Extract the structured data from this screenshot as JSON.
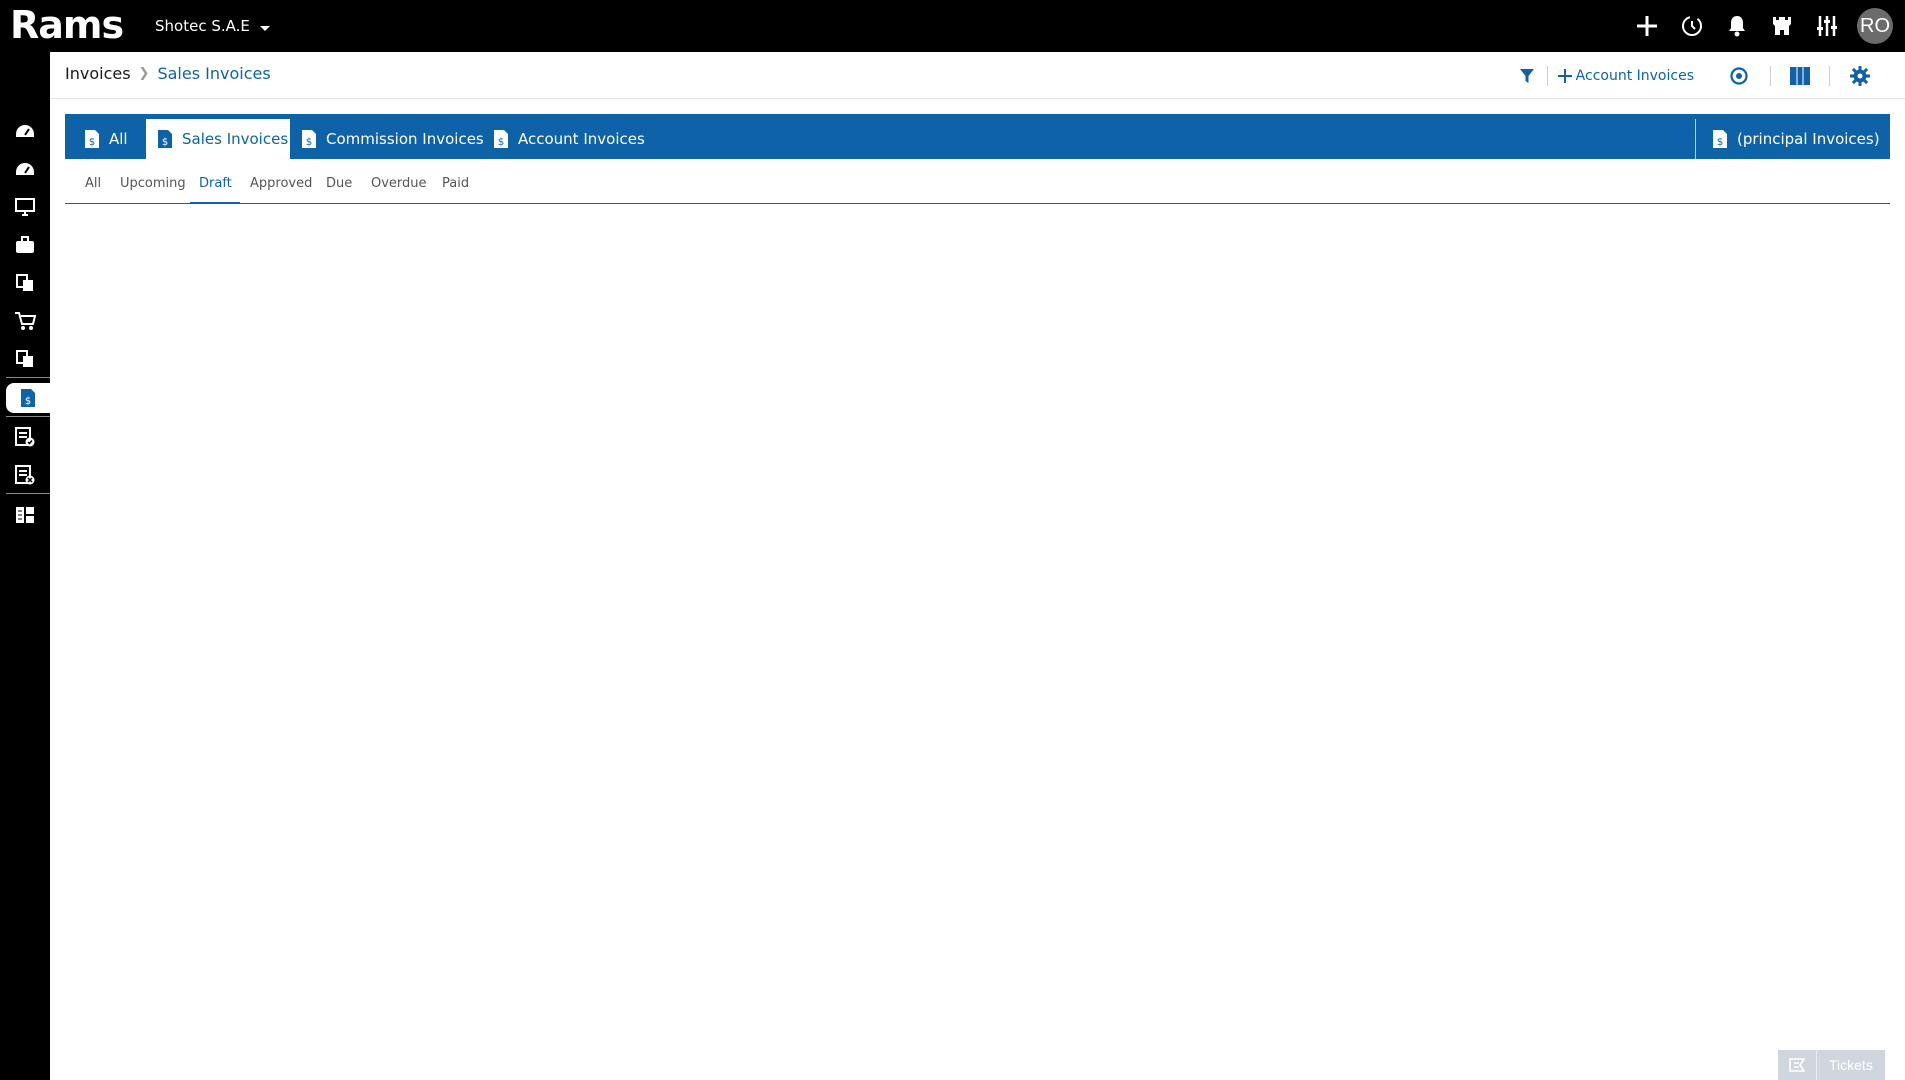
{
  "app": {
    "logo_text": "Rams",
    "company": "Shotec S.A.E",
    "user_initials": "RO"
  },
  "topbar_icons": [
    "plus-icon",
    "history-icon",
    "bell-icon",
    "castle-icon",
    "sliders-icon"
  ],
  "sidebar": {
    "items": [
      {
        "icon": "dashboard-icon"
      },
      {
        "icon": "dashboard-icon"
      },
      {
        "icon": "monitor-icon"
      },
      {
        "icon": "briefcase-icon"
      },
      {
        "icon": "documents-icon"
      },
      {
        "icon": "cart-icon"
      },
      {
        "icon": "documents-icon"
      },
      {
        "icon": "invoice-icon",
        "active": true
      },
      {
        "icon": "invoice-check-icon"
      },
      {
        "icon": "invoice-cancel-icon"
      },
      {
        "icon": "layout-icon"
      }
    ]
  },
  "breadcrumb": {
    "root": "Invoices",
    "current": "Sales Invoices"
  },
  "header_actions": {
    "add_label": "Account Invoices"
  },
  "tabs": [
    {
      "label": "All",
      "icon": "invoice-icon"
    },
    {
      "label": "Sales Invoices",
      "icon": "invoice-icon",
      "active": true
    },
    {
      "label": "Commission Invoices",
      "icon": "invoice-icon"
    },
    {
      "label": "Account Invoices",
      "icon": "invoice-icon"
    }
  ],
  "right_tab": {
    "label": "(principal Invoices)",
    "icon": "invoice-icon"
  },
  "status_tabs": [
    {
      "label": "All"
    },
    {
      "label": "Upcoming"
    },
    {
      "label": "Draft",
      "active": true
    },
    {
      "label": "Approved"
    },
    {
      "label": "Due"
    },
    {
      "label": "Overdue"
    },
    {
      "label": "Paid"
    }
  ],
  "tickets": {
    "label": "Tickets"
  },
  "colors": {
    "brand_blue": "#0d62a8",
    "topbar": "#000000",
    "tickets_bg": "#cfd6de"
  }
}
